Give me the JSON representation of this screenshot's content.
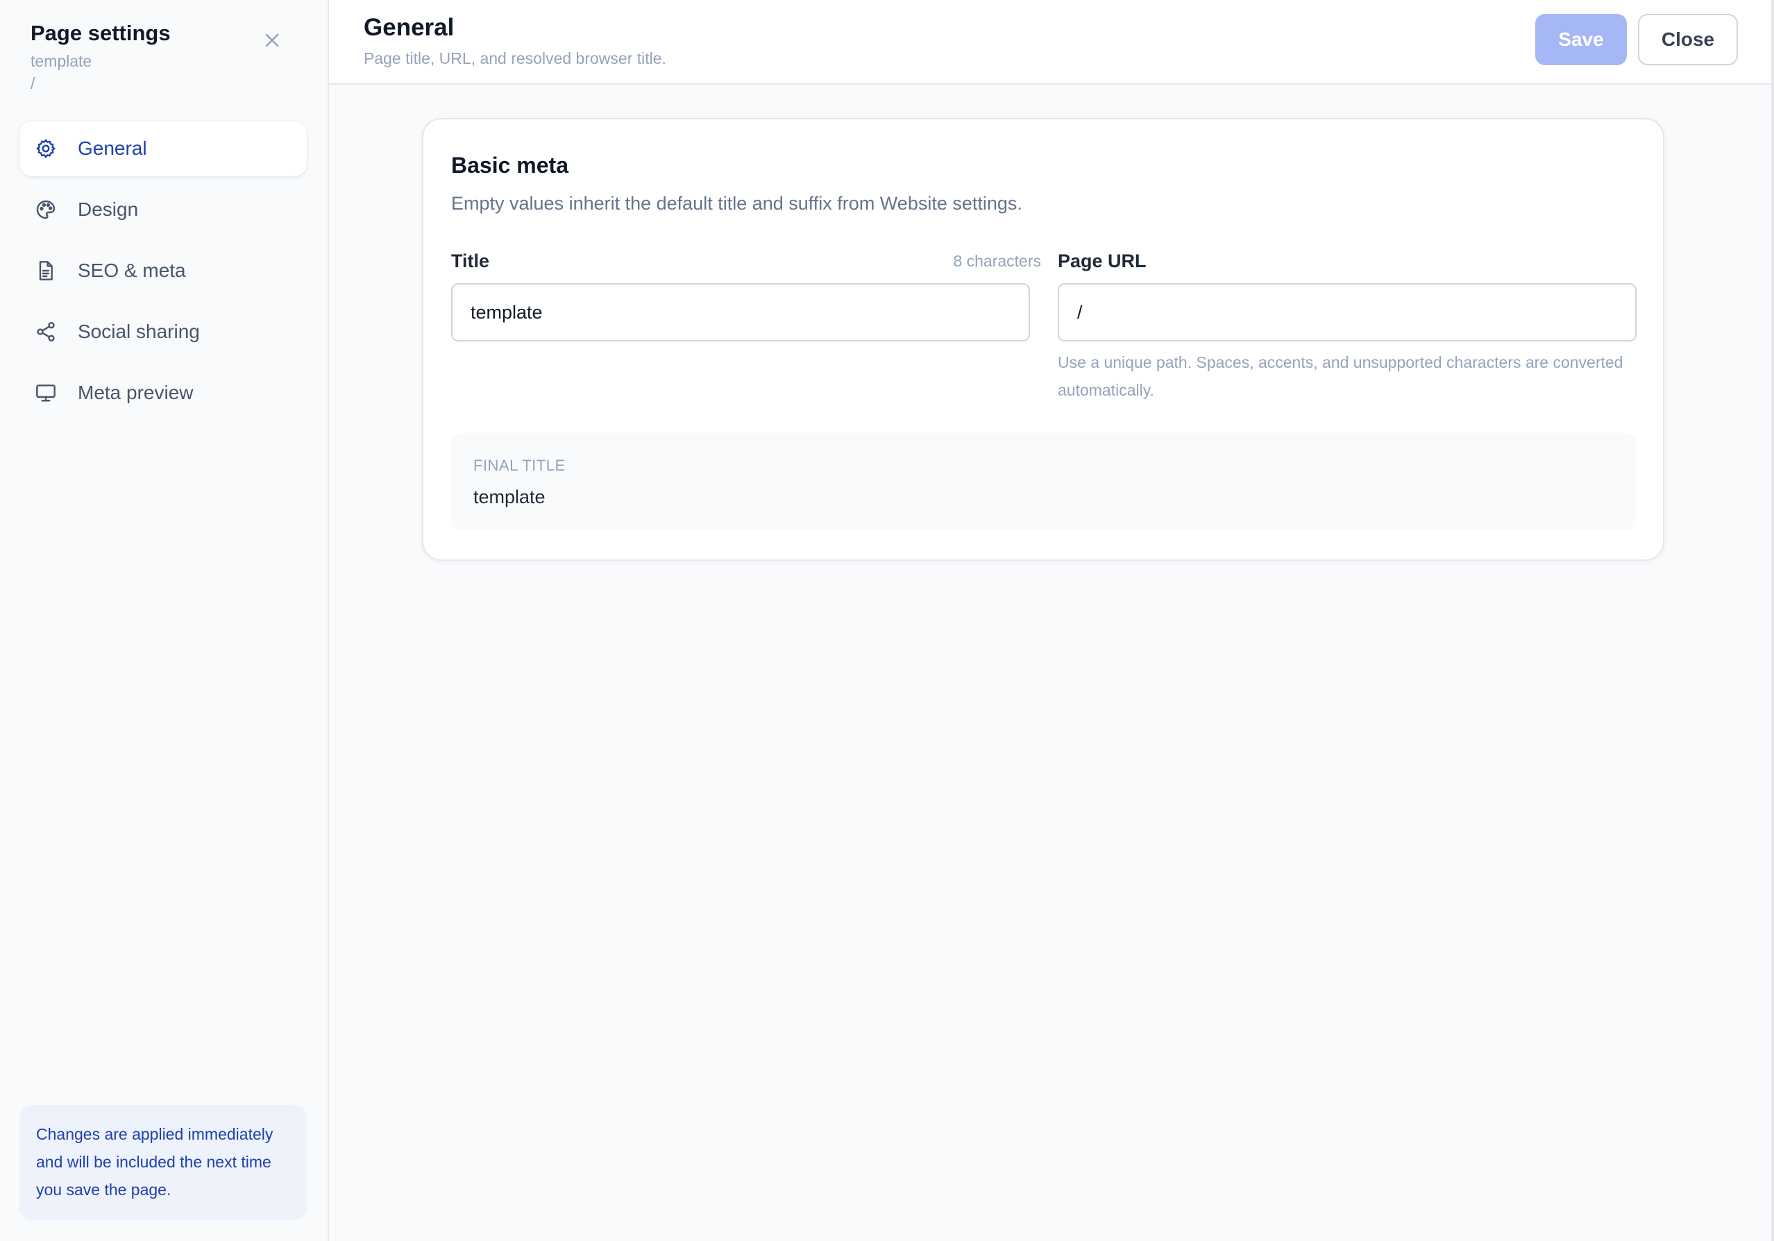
{
  "sidebar": {
    "title": "Page settings",
    "page_name": "template",
    "page_path": "/",
    "items": [
      {
        "label": "General",
        "icon": "gear-icon",
        "active": true
      },
      {
        "label": "Design",
        "icon": "palette-icon",
        "active": false
      },
      {
        "label": "SEO & meta",
        "icon": "document-icon",
        "active": false
      },
      {
        "label": "Social sharing",
        "icon": "share-icon",
        "active": false
      },
      {
        "label": "Meta preview",
        "icon": "monitor-icon",
        "active": false
      }
    ],
    "info": "Changes are applied immediately and will be included the next time you save the page."
  },
  "header": {
    "title": "General",
    "subtitle": "Page title, URL, and resolved browser title.",
    "save_label": "Save",
    "close_label": "Close"
  },
  "card": {
    "title": "Basic meta",
    "description": "Empty values inherit the default title and suffix from Website settings.",
    "title_field": {
      "label": "Title",
      "value": "template",
      "count": "8 characters"
    },
    "url_field": {
      "label": "Page URL",
      "value": "/",
      "hint": "Use a unique path. Spaces, accents, and unsupported characters are converted automatically."
    },
    "final": {
      "label": "FINAL TITLE",
      "value": "template"
    }
  },
  "colors": {
    "accent": "#1e40af",
    "save_button": "#a5b8f5",
    "background": "#f8fafc"
  }
}
